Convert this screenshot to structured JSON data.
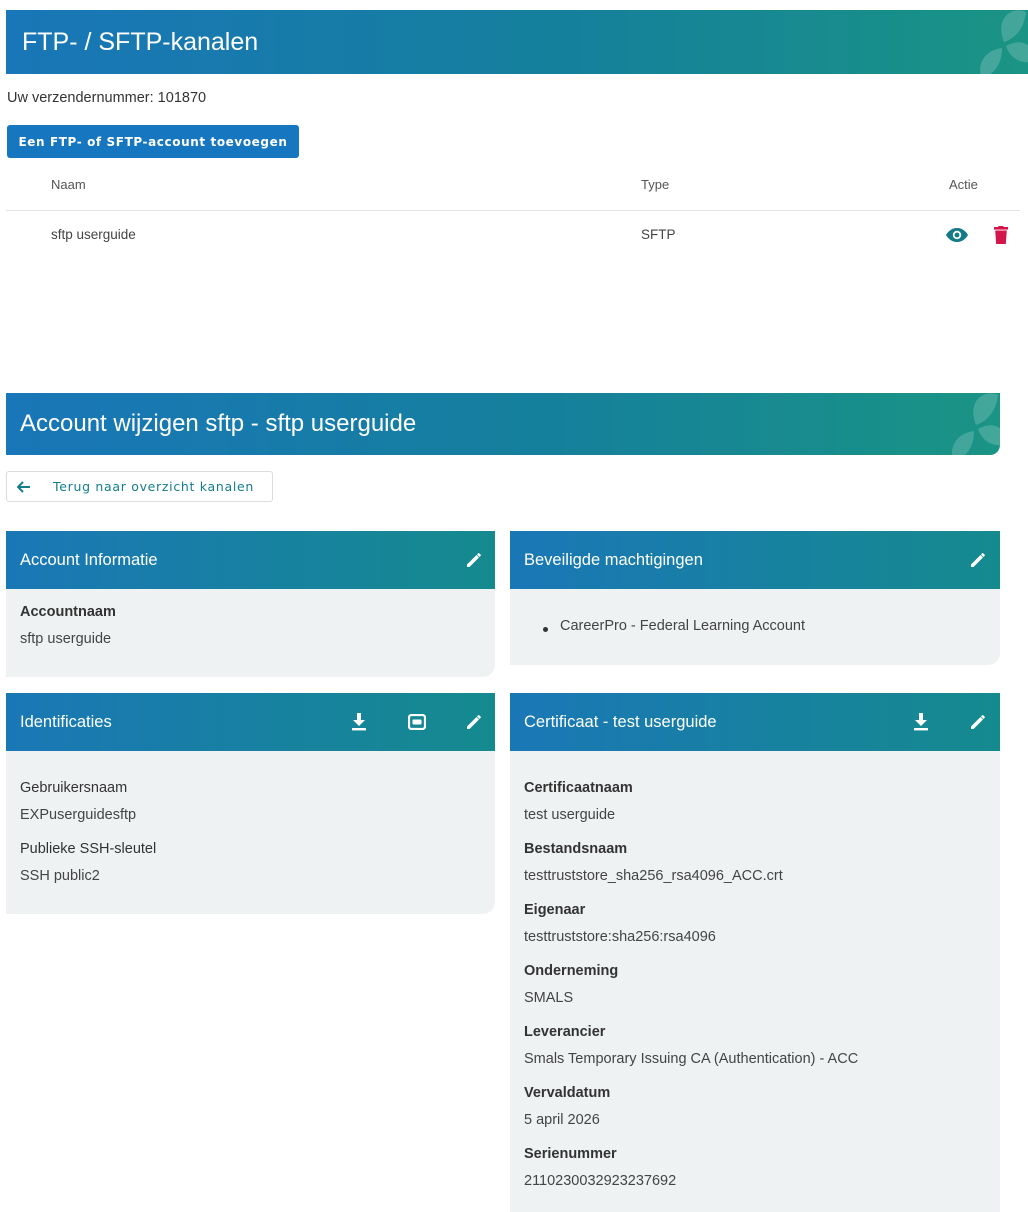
{
  "ftp_section": {
    "title": "FTP- / SFTP-kanalen",
    "sender_number": "Uw verzendernummer: 101870",
    "add_button": "Een FTP- of SFTP-account toevoegen",
    "table": {
      "columns": [
        "Naam",
        "Type",
        "Actie"
      ],
      "rows": [
        {
          "name": "sftp userguide",
          "type": "SFTP"
        }
      ]
    }
  },
  "edit_section": {
    "title": "Account wijzigen sftp - sftp userguide",
    "back_button": "Terug naar overzicht kanalen",
    "account_info": {
      "title": "Account Informatie",
      "label": "Accountnaam",
      "value": "sftp userguide"
    },
    "permissions": {
      "title": "Beveiligde machtigingen",
      "items": [
        "CareerPro - Federal Learning Account"
      ]
    },
    "identifications": {
      "title": "Identificaties",
      "username_label": "Gebruikersnaam",
      "username_value": "EXPuserguidesftp",
      "ssh_label": "Publieke SSH-sleutel",
      "ssh_value": "SSH public2"
    },
    "certificate": {
      "title": "Certificaat - test userguide",
      "fields": [
        {
          "label": "Certificaatnaam",
          "value": "test userguide"
        },
        {
          "label": "Bestandsnaam",
          "value": "testtruststore_sha256_rsa4096_ACC.crt"
        },
        {
          "label": "Eigenaar",
          "value": "testtruststore:sha256:rsa4096"
        },
        {
          "label": "Onderneming",
          "value": "SMALS"
        },
        {
          "label": "Leverancier",
          "value": "Smals Temporary Issuing CA (Authentication) - ACC"
        },
        {
          "label": "Vervaldatum",
          "value": "5 april 2026"
        },
        {
          "label": "Serienummer",
          "value": "2110230032923237692"
        }
      ]
    }
  },
  "colors": {
    "banner_start": "#1976b8",
    "banner_end": "#1a9484",
    "button_blue": "#1776c0",
    "teal_icon": "#147a87",
    "delete_red": "#d4154c",
    "card_bg": "#eff2f3"
  },
  "icons": {
    "view": "eye-icon",
    "delete": "trash-icon",
    "edit": "pencil-icon",
    "download": "download-icon",
    "key": "key-card-icon",
    "back": "arrow-left-icon"
  }
}
